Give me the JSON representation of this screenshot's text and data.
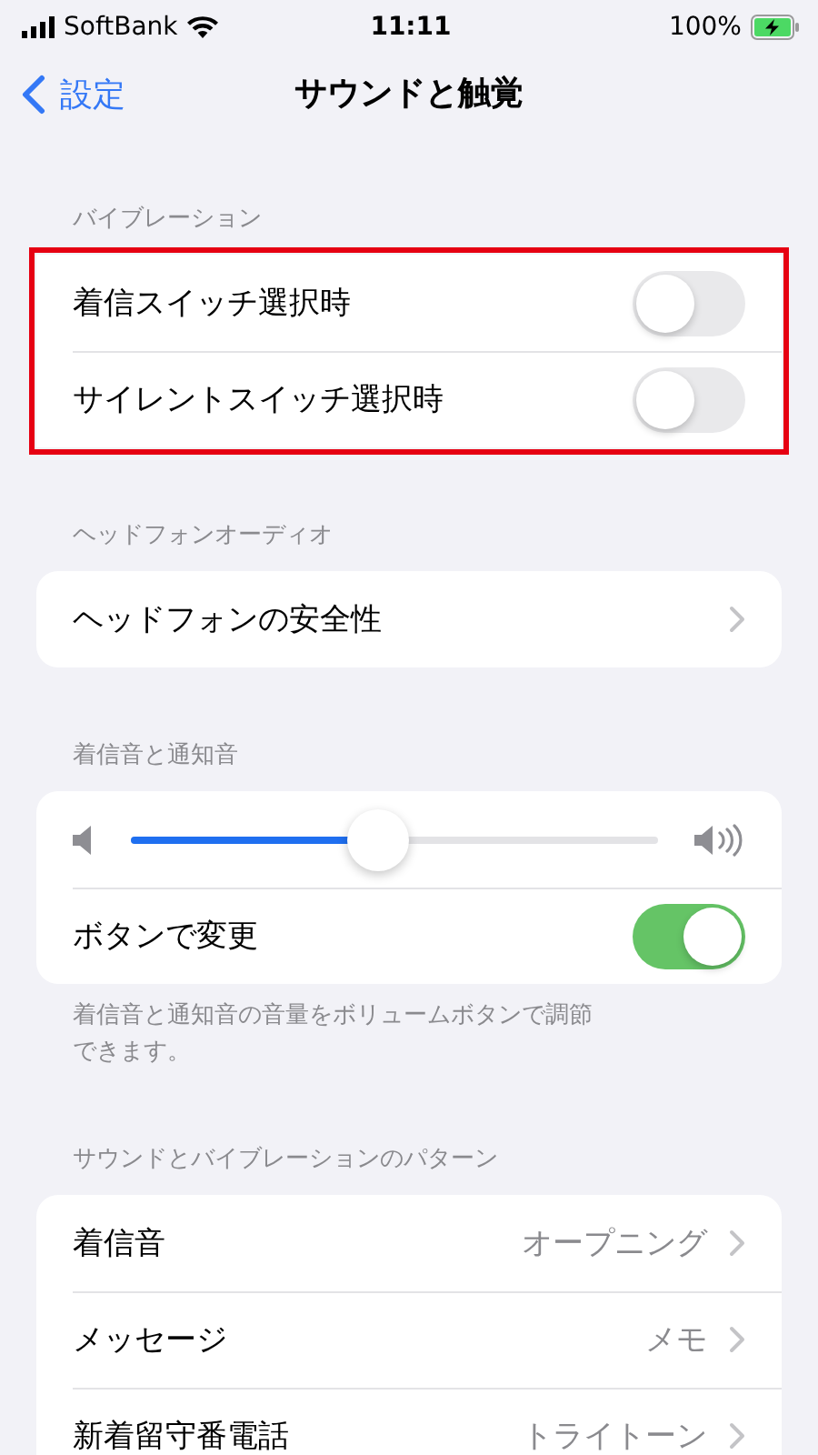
{
  "status_bar": {
    "carrier": "SoftBank",
    "time": "11:11",
    "battery": "100%",
    "charging": true
  },
  "nav": {
    "back": "設定",
    "title": "サウンドと触覚"
  },
  "sections": [
    {
      "header": "バイブレーション",
      "highlighted": true,
      "rows": [
        {
          "kind": "toggle",
          "label": "着信スイッチ選択時",
          "on": false
        },
        {
          "kind": "toggle",
          "label": "サイレントスイッチ選択時",
          "on": false
        }
      ]
    },
    {
      "header": "ヘッドフォンオーディオ",
      "highlighted": false,
      "rows": [
        {
          "kind": "link",
          "label": "ヘッドフォンの安全性"
        }
      ]
    },
    {
      "header": "着信音と通知音",
      "highlighted": false,
      "rows": [
        {
          "kind": "slider",
          "level": 0.47
        },
        {
          "kind": "toggle",
          "label": "ボタンで変更",
          "on": true
        }
      ],
      "footer": "着信音と通知音の音量をボリュームボタンで調節できます。"
    },
    {
      "header": "サウンドとバイブレーションのパターン",
      "highlighted": false,
      "rows": [
        {
          "kind": "link",
          "label": "着信音",
          "value": "オープニング"
        },
        {
          "kind": "link",
          "label": "メッセージ",
          "value": "メモ"
        },
        {
          "kind": "link",
          "label": "新着留守番電話",
          "value": "トライトーン"
        }
      ]
    }
  ]
}
